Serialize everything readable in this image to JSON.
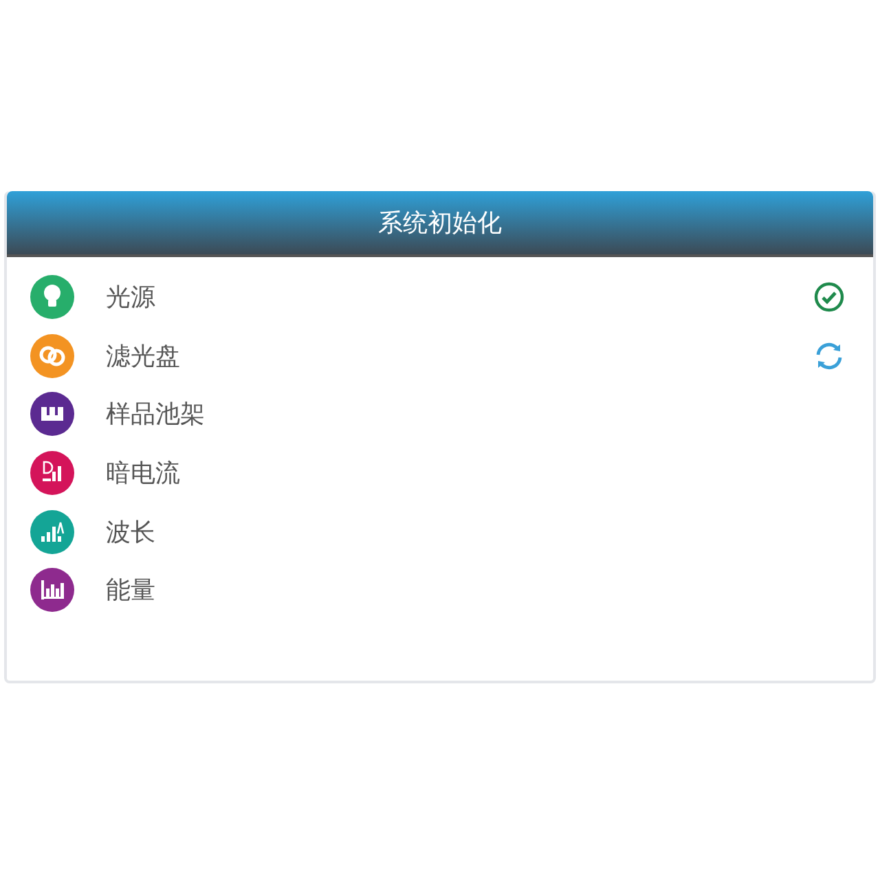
{
  "panel": {
    "title": "系统初始化"
  },
  "items": [
    {
      "label": "光源",
      "color": "#27ae6b",
      "completed": true,
      "in_progress": false
    },
    {
      "label": "滤光盘",
      "color": "#f39322",
      "completed": false,
      "in_progress": true
    },
    {
      "label": "样品池架",
      "color": "#5b2a91",
      "completed": false,
      "in_progress": false
    },
    {
      "label": "暗电流",
      "color": "#d4145a",
      "completed": false,
      "in_progress": false
    },
    {
      "label": "波长",
      "color": "#14a596",
      "completed": false,
      "in_progress": false
    },
    {
      "label": "能量",
      "color": "#8e2a8e",
      "completed": false,
      "in_progress": false
    }
  ]
}
